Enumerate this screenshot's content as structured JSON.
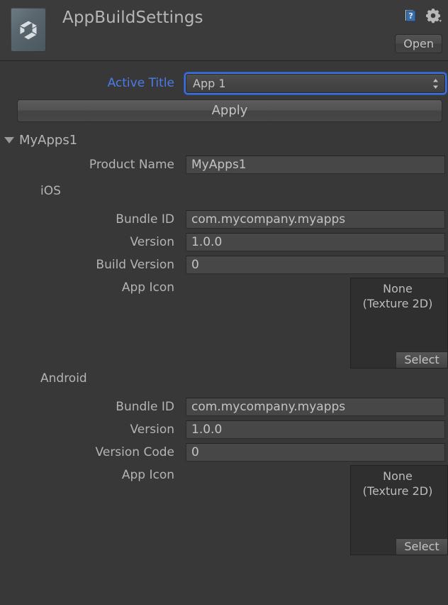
{
  "header": {
    "title": "AppBuildSettings",
    "logo_icon": "unity-logo-icon",
    "help_icon": "help-book-icon",
    "gear_icon": "gear-settings-icon",
    "open_label": "Open"
  },
  "accent_color": "#4a7ce8",
  "background_color": "#383838",
  "active_title": {
    "label": "Active Title",
    "value": "App 1",
    "options": [
      "App 1"
    ]
  },
  "apply_button": {
    "label": "Apply"
  },
  "foldout": {
    "label": "MyApps1",
    "expanded": true,
    "arrow_icon": "triangle-down-icon"
  },
  "product_name": {
    "label": "Product Name",
    "value": "MyApps1"
  },
  "ios": {
    "section_label": "iOS",
    "bundle_id": {
      "label": "Bundle ID",
      "value": "com.mycompany.myapps"
    },
    "version": {
      "label": "Version",
      "value": "1.0.0"
    },
    "build_version": {
      "label": "Build Version",
      "value": "0"
    },
    "app_icon": {
      "label": "App Icon",
      "value_line1": "None",
      "value_line2": "(Texture 2D)",
      "select_label": "Select"
    }
  },
  "android": {
    "section_label": "Android",
    "bundle_id": {
      "label": "Bundle ID",
      "value": "com.mycompany.myapps"
    },
    "version": {
      "label": "Version",
      "value": "1.0.0"
    },
    "version_code": {
      "label": "Version Code",
      "value": "0"
    },
    "app_icon": {
      "label": "App Icon",
      "value_line1": "None",
      "value_line2": "(Texture 2D)",
      "select_label": "Select"
    }
  }
}
